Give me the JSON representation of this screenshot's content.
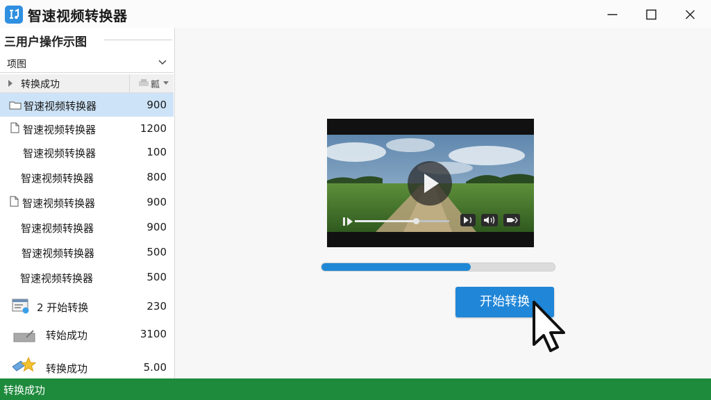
{
  "app": {
    "title": "智速视频转换器"
  },
  "sidebar": {
    "header": "三用户操作示图",
    "combo_value": "项图",
    "column_header": {
      "name_label": "转换成功",
      "size_label": "瓤"
    },
    "items": [
      {
        "name": "智速视频转换器",
        "value": "900",
        "icon": "folder-icon",
        "selected": true
      },
      {
        "name": "智速视频转换器",
        "value": "1200",
        "icon": "file-icon"
      },
      {
        "name": "智速视频转换器",
        "value": "100",
        "icon": "none"
      },
      {
        "name": "智速视频转换器",
        "value": "800",
        "icon": "none"
      },
      {
        "name": "智速视频转换器",
        "value": "900",
        "icon": "file-icon"
      },
      {
        "name": "智速视频转换器",
        "value": "900",
        "icon": "none"
      },
      {
        "name": "智速视频转换器",
        "value": "500",
        "icon": "none"
      },
      {
        "name": "智速视频转换器",
        "value": "500",
        "icon": "none"
      },
      {
        "name": "2 开始转换",
        "value": "230",
        "icon": "window-app-icon"
      },
      {
        "name": "转始成功",
        "value": "3100",
        "icon": "tray-icon"
      },
      {
        "name": "转换成功",
        "value": "5.00",
        "icon": "star-tag-icon"
      }
    ]
  },
  "player": {
    "state": "paused",
    "seek_fraction": 0.65,
    "controls": [
      "play-pause-icon",
      "seek-bar",
      "skip-forward-icon",
      "volume-icon",
      "fullscreen-icon"
    ]
  },
  "conversion": {
    "progress_fraction": 0.64,
    "start_button_label": "开始转换"
  },
  "status": {
    "text": "转换成功"
  },
  "colors": {
    "accent": "#1f86d8",
    "status_bar": "#1e8a3c",
    "selected_row": "#cde3f7"
  }
}
